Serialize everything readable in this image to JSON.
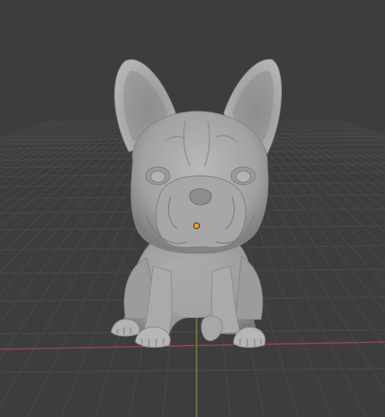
{
  "viewport": {
    "mode": "3d-viewport",
    "object": "french-bulldog-sculpt",
    "background_color": "#3d3d3d",
    "grid_color": "#4a4a4a",
    "x_axis_color": "#b0434a",
    "y_axis_color": "#6e9a2c",
    "model_color": "#a9a9a9",
    "origin_color": "#f29b27"
  }
}
